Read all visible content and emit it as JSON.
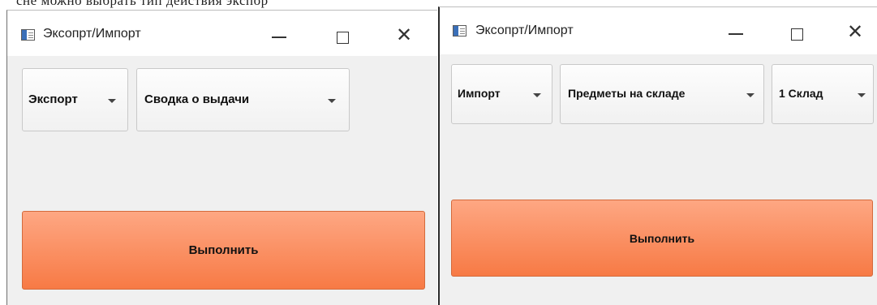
{
  "background": {
    "text": "сне можно выбрать тип действия экспор"
  },
  "windows": [
    {
      "title": "Эксопрт/Импорт",
      "combos": [
        "Экспорт",
        "Сводка о выдачи"
      ],
      "execute_label": "Выполнить"
    },
    {
      "title": "Эксопрт/Импорт",
      "combos": [
        "Импорт",
        "Предметы на складе",
        "1 Склад"
      ],
      "execute_label": "Выполнить"
    }
  ],
  "colors": {
    "accent_top": "#fea783",
    "accent_bottom": "#f77a45",
    "window_bg": "#f0f0f0",
    "titlebar_bg": "#ffffff"
  },
  "icons": {
    "app": "app-window-icon",
    "minimize": "minimize-icon",
    "maximize": "maximize-icon",
    "close": "close-icon",
    "dropdown": "chevron-down-icon"
  }
}
